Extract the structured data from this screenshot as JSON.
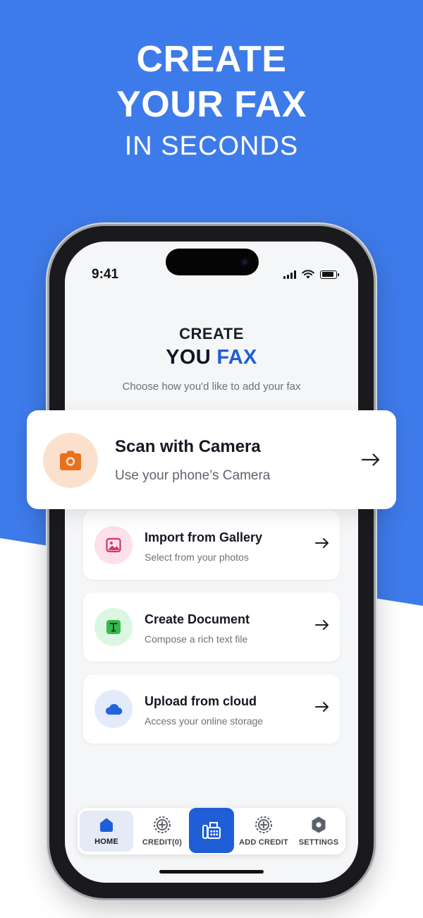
{
  "hero": {
    "line1": "CREATE",
    "line2": "YOUR FAX",
    "line3": "IN SECONDS"
  },
  "status_bar": {
    "time": "9:41"
  },
  "screen": {
    "title_line1": "CREATE",
    "title_line2_part1": "YOU",
    "title_line2_part2": "FAX",
    "subtitle": "Choose how you'd like to add your fax"
  },
  "options": [
    {
      "title": "Scan with Camera",
      "subtitle": "Use your phone’s Camera",
      "icon": "camera-icon",
      "icon_bg": "#fbe1cd",
      "icon_color": "#e8711c"
    },
    {
      "title": "Import from Gallery",
      "subtitle": "Select from your photos",
      "icon": "gallery-icon",
      "icon_bg": "#fde0ea",
      "icon_color": "#d6336c"
    },
    {
      "title": "Create Document",
      "subtitle": "Compose a rich text file",
      "icon": "text-document-icon",
      "icon_bg": "#dcf7e1",
      "icon_color": "#34b94f"
    },
    {
      "title": "Upload from cloud",
      "subtitle": "Access your online storage",
      "icon": "cloud-icon",
      "icon_bg": "#e3ebfb",
      "icon_color": "#2366dc"
    }
  ],
  "bottom_nav": {
    "items": [
      {
        "label": "HOME",
        "icon": "home-icon",
        "active": true
      },
      {
        "label": "CREDIT(0)",
        "icon": "credit-icon"
      },
      {
        "label": "",
        "icon": "fax-icon"
      },
      {
        "label": "ADD CREDIT",
        "icon": "add-credit-icon"
      },
      {
        "label": "SETTINGS",
        "icon": "settings-icon"
      }
    ]
  },
  "colors": {
    "brand_blue": "#3E7BEA",
    "accent_blue": "#1f5ed6"
  }
}
